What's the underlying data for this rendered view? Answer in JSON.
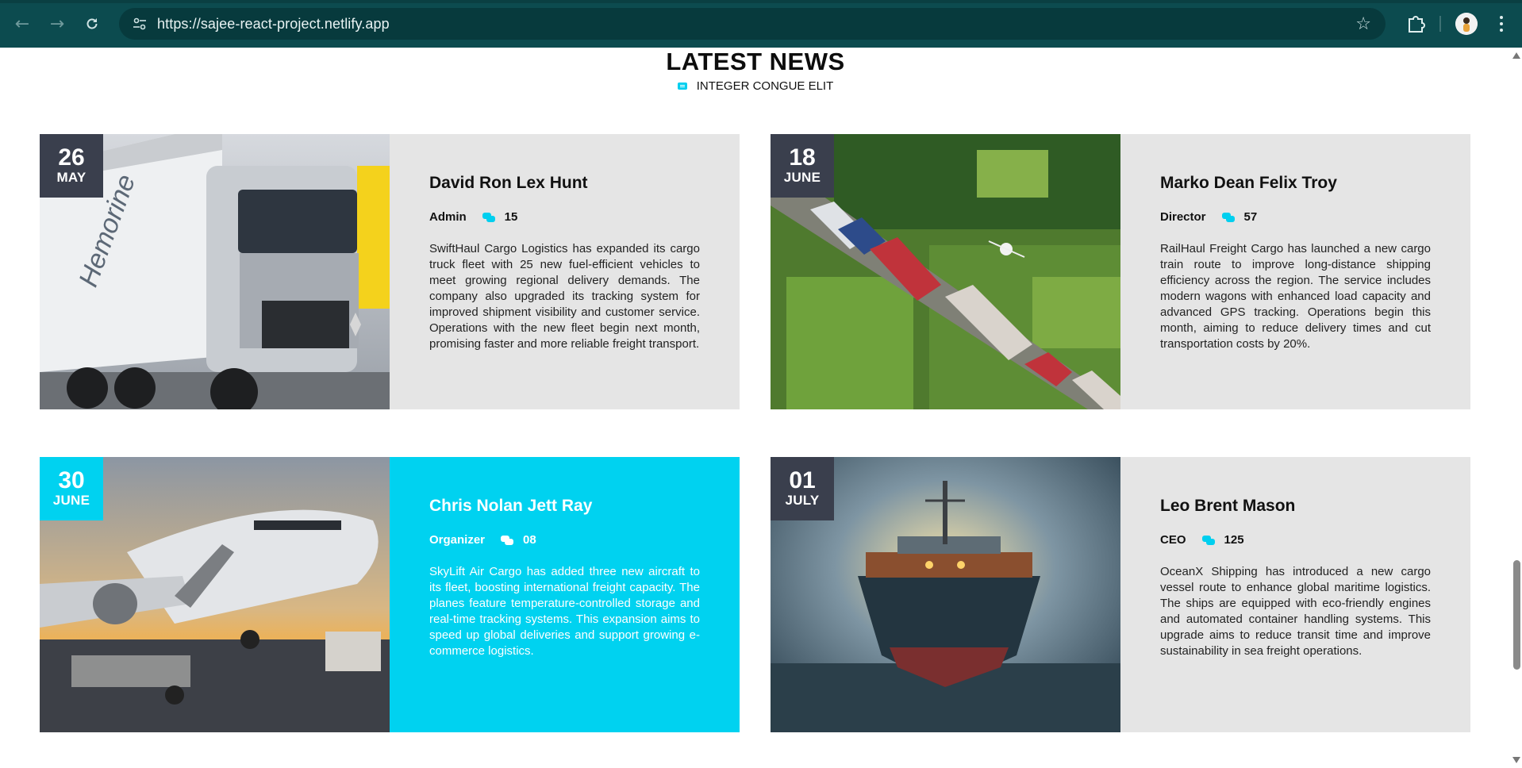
{
  "browser": {
    "url": "https://sajee-react-project.netlify.app",
    "icons": {
      "back": "back-arrow-icon",
      "forward": "forward-arrow-icon",
      "reload": "reload-icon",
      "site_info": "tune-icon",
      "bookmark": "star-icon",
      "extensions": "puzzle-icon",
      "menu": "kebab-menu-icon"
    }
  },
  "section": {
    "title": "LATEST NEWS",
    "subtitle": "INTEGER CONGUE ELIT"
  },
  "colors": {
    "accent": "#00d2f0",
    "date_badge": "#3a3f4d",
    "card_bg": "#e5e5e5",
    "chrome": "#0c4b4f"
  },
  "news": [
    {
      "day": "26",
      "month": "MAY",
      "name": "David Ron Lex Hunt",
      "role": "Admin",
      "comments": "15",
      "text": "SwiftHaul Cargo Logistics has expanded its cargo truck fleet with 25 new fuel-efficient vehicles to meet growing regional delivery demands. The company also upgraded its tracking system for improved shipment visibility and customer service. Operations with the new fleet begin next month, promising faster and more reliable freight transport.",
      "image": "cargo-truck-photo"
    },
    {
      "day": "18",
      "month": "JUNE",
      "name": "Marko Dean Felix Troy",
      "role": "Director",
      "comments": "57",
      "text": "RailHaul Freight Cargo has launched a new cargo train route to improve long-distance shipping efficiency across the region. The service includes modern wagons with enhanced load capacity and advanced GPS tracking. Operations begin this month, aiming to reduce delivery times and cut transportation costs by 20%.",
      "image": "freight-train-photo"
    },
    {
      "day": "30",
      "month": "JUNE",
      "name": "Chris Nolan Jett Ray",
      "role": "Organizer",
      "comments": "08",
      "text": "SkyLift Air Cargo has added three new aircraft to its fleet, boosting international freight capacity. The planes feature temperature-controlled storage and real-time tracking systems. This expansion aims to speed up global deliveries and support growing e-commerce logistics.",
      "image": "cargo-plane-photo"
    },
    {
      "day": "01",
      "month": "JULY",
      "name": "Leo Brent Mason",
      "role": "CEO",
      "comments": "125",
      "text": "OceanX Shipping has introduced a new cargo vessel route to enhance global maritime logistics. The ships are equipped with eco-friendly engines and automated container handling systems. This upgrade aims to reduce transit time and improve sustainability in sea freight operations.",
      "image": "cargo-ship-photo"
    }
  ]
}
